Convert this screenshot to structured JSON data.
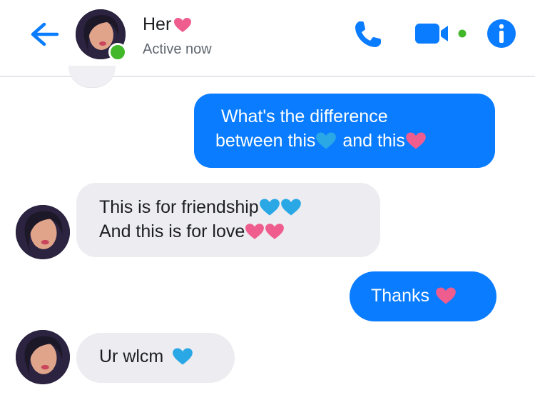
{
  "header": {
    "contact_name": "Her",
    "status": "Active now"
  },
  "icons": {
    "back": "arrow-left-icon",
    "call": "phone-icon",
    "video": "video-camera-icon",
    "info": "info-icon",
    "heart_pink": "pink-heart-icon",
    "heart_blue": "blue-heart-icon"
  },
  "colors": {
    "accent": "#0a7cff",
    "incoming_bubble": "#ececf1",
    "online": "#42b72a",
    "pink_heart": "#ef5d8e",
    "blue_heart": "#2aa8e6"
  },
  "messages": [
    {
      "sender": "me",
      "lines": [
        "What's the difference",
        "between this",
        "and this"
      ]
    },
    {
      "sender": "her",
      "lines": [
        "This is for friendship",
        "And this is for love"
      ]
    },
    {
      "sender": "me",
      "lines": [
        "Thanks"
      ]
    },
    {
      "sender": "her",
      "lines": [
        "Ur wlcm"
      ]
    }
  ]
}
